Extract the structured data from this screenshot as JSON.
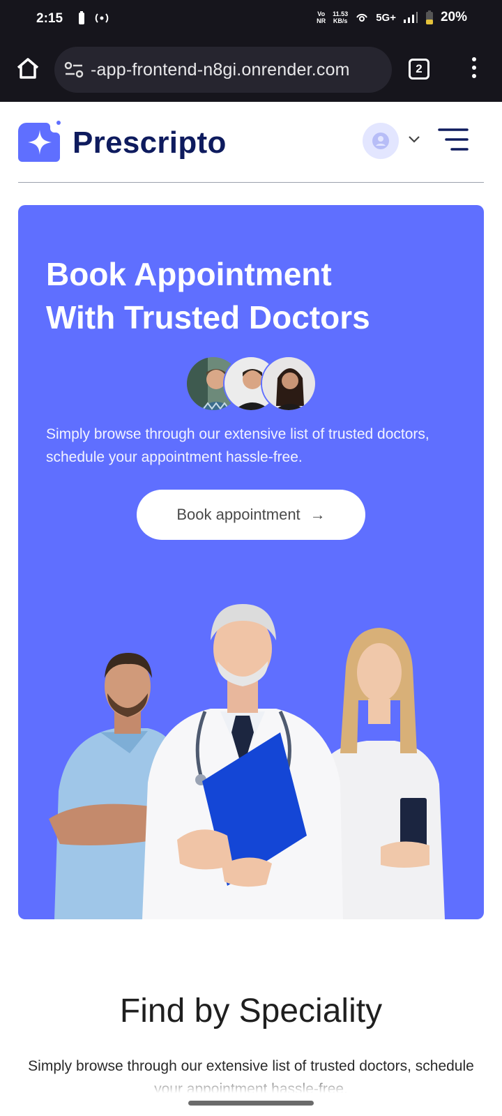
{
  "status_bar": {
    "time": "2:15",
    "network_speed_value": "11.53",
    "network_speed_unit": "KB/s",
    "vo_label": "Vo",
    "nr_label": "NR",
    "network_type": "5G+",
    "battery_percent": "20%"
  },
  "browser": {
    "url": "-app-frontend-n8gi.onrender.com",
    "tab_count": "2"
  },
  "header": {
    "logo_text": "Prescripto"
  },
  "hero": {
    "title_line1": "Book Appointment",
    "title_line2": "With Trusted Doctors",
    "subtitle": "Simply browse through our extensive list of trusted doctors, schedule your appointment hassle-free.",
    "cta_label": "Book appointment",
    "cta_arrow": "→"
  },
  "speciality": {
    "title": "Find by Speciality",
    "subtitle": "Simply browse through our extensive list of trusted doctors, schedule your appointment hassle-free."
  },
  "colors": {
    "brand": "#5f6fff",
    "brand_dark": "#0e1b5e",
    "browser_chrome": "#16151c"
  }
}
